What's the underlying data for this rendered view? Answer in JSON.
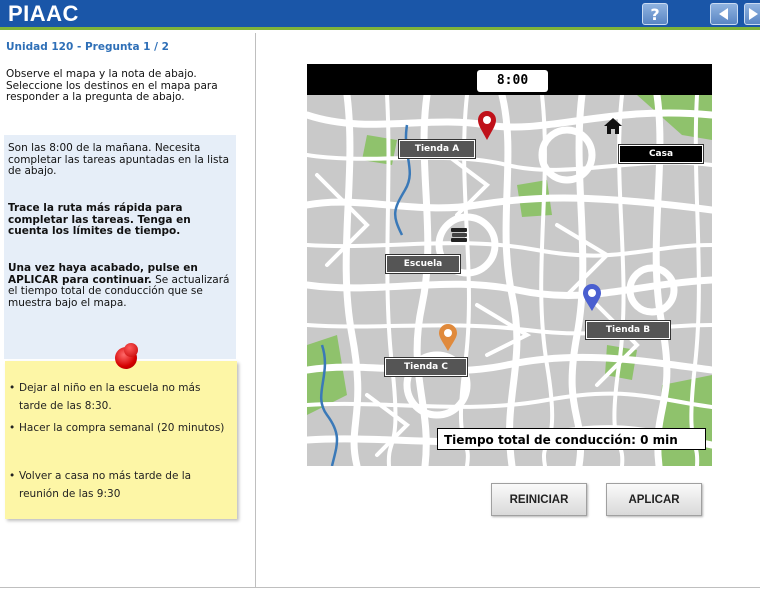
{
  "header": {
    "logo": "PIAAC",
    "help_label": "?"
  },
  "unit_title": "Unidad 120 - Pregunta 1 / 2",
  "instructions": "Observe el mapa y la nota de abajo. Seleccione los destinos en el mapa para responder a la pregunta de abajo.",
  "task": {
    "p1": "Son las 8:00 de la mañana. Necesita completar las tareas apuntadas en la lista de abajo.",
    "p2": "Trace la ruta más rápida para completar las tareas. Tenga en cuenta los límites de tiempo.",
    "p3_bold": "Una vez haya acabado, pulse en APLICAR para continuar.",
    "p3_rest": " Se actualizará el tiempo total de conducción que se muestra bajo el mapa."
  },
  "note": {
    "items": [
      "Dejar al niño en la escuela no más tarde de las 8:30.",
      "Hacer la compra semanal (20 minutos)",
      "Volver a casa no más tarde de la reunión de las 9:30"
    ]
  },
  "map": {
    "clock": "8:00",
    "labels": {
      "tienda_a": "Tienda A",
      "casa": "Casa",
      "escuela": "Escuela",
      "tienda_b": "Tienda B",
      "tienda_c": "Tienda C"
    },
    "drive_time": "Tiempo total de conducción: 0 min",
    "colors": {
      "road": "#ffffff",
      "block": "#c9c9c9",
      "park": "#8fc26c",
      "water": "#3a79b8",
      "pin_a": "#c0111a",
      "pin_b": "#4a5fd0",
      "pin_c": "#e08a3c"
    }
  },
  "buttons": {
    "reset": "REINICIAR",
    "apply": "APLICAR"
  }
}
